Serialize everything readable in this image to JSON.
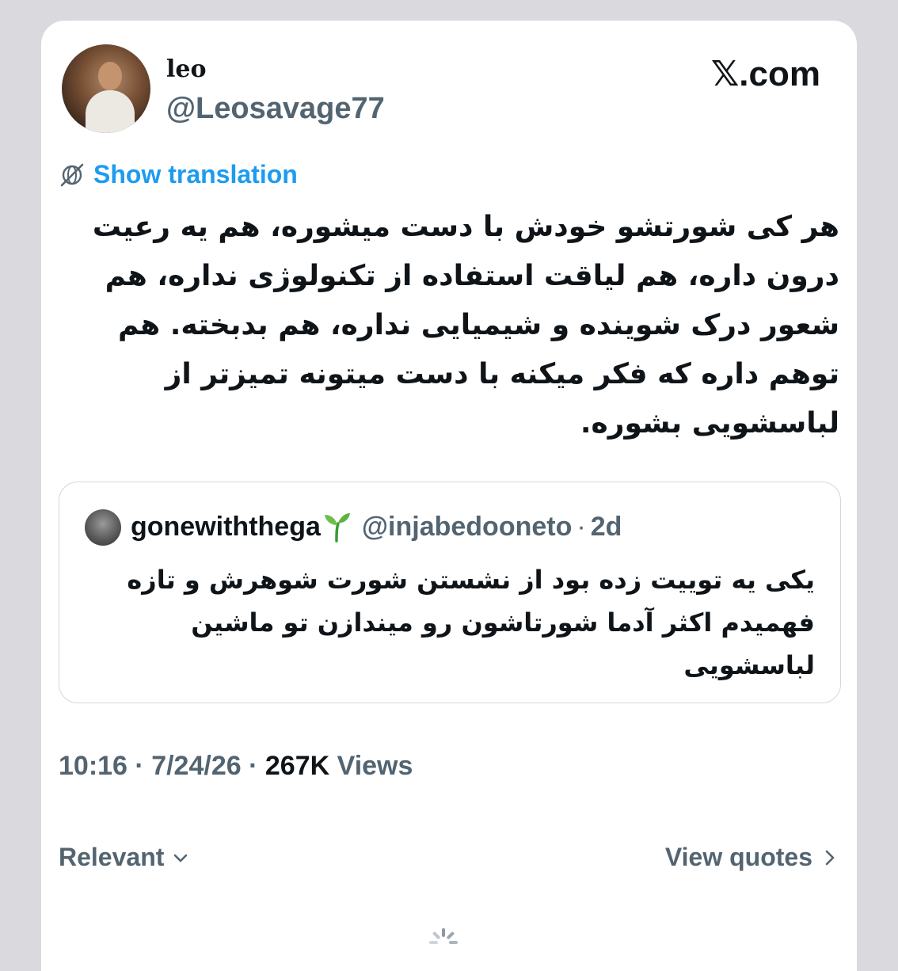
{
  "author": {
    "display_name": "leo",
    "handle": "@Leosavage77",
    "avatar_icon": "profile-photo"
  },
  "brand": "𝕏.com",
  "translation": {
    "link_text": "Show translation",
    "icon": "globe-slash-icon"
  },
  "tweet": {
    "text": "هر کی شورتشو خودش با دست میشوره، هم یه رعیت درون داره، هم لیاقت استفاده از تکنولوژی نداره، هم شعور درک شوینده و شیمیایی نداره، هم بدبخته. هم توهم داره که فکر میکنه با دست میتونه تمیزتر از لباسشویی بشوره."
  },
  "quote": {
    "name": "gonewiththega",
    "emoji": "🌱",
    "handle": "@injabedooneto",
    "separator": "·",
    "time": "2d",
    "text": "یکی یه توییت زده بود از نشستن شورت شوهرش و تازه فهمیدم اکثر آدما شورتاشون رو میندازن تو ماشین لباسشویی"
  },
  "meta": {
    "time": "10:16",
    "date": "7/24/26",
    "views_count": "267K",
    "views_label": "Views",
    "separator": "·"
  },
  "actions": {
    "sort_label": "Relevant",
    "quotes_label": "View quotes"
  },
  "colors": {
    "accent": "#1d9bf0",
    "text": "#0f1419",
    "secondary": "#536471",
    "border": "#cfd9de",
    "page_bg": "#d9d9de"
  }
}
